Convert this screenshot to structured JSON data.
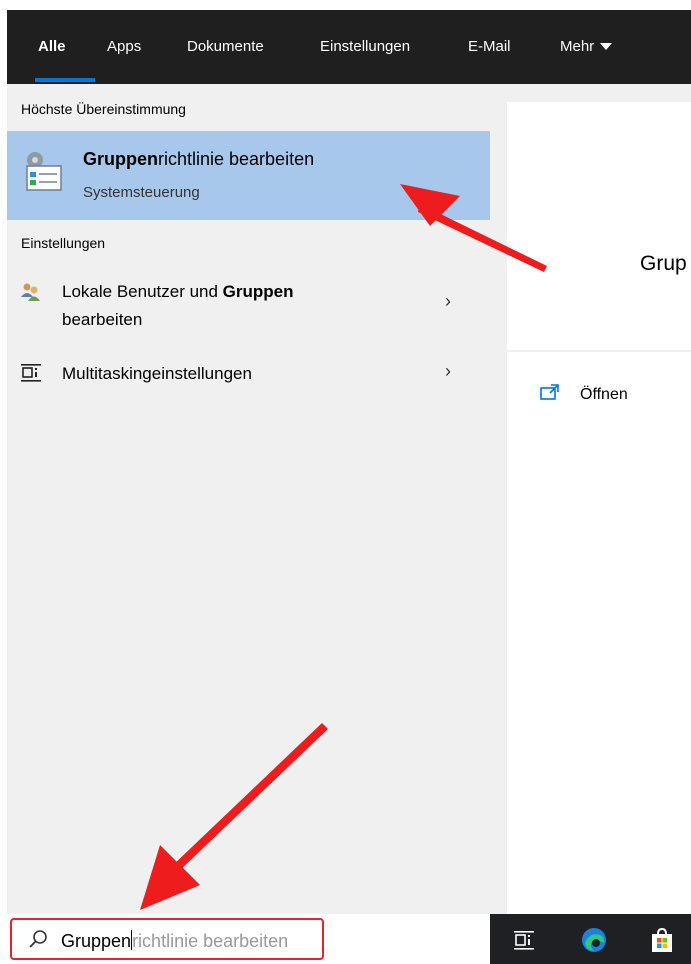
{
  "tabs": [
    {
      "label": "Alle"
    },
    {
      "label": "Apps"
    },
    {
      "label": "Dokumente"
    },
    {
      "label": "Einstellungen"
    },
    {
      "label": "E-Mail"
    },
    {
      "label": "Mehr"
    }
  ],
  "best_match": {
    "section_label": "Höchste Übereinstimmung",
    "title_bold": "Gruppen",
    "title_rest": "richtlinie bearbeiten",
    "subtitle": "Systemsteuerung",
    "icon": "group-policy-icon"
  },
  "settings": {
    "section_label": "Einstellungen",
    "items": [
      {
        "line1_prefix": "Lokale Benutzer und ",
        "line1_bold": "Gruppen",
        "line2": "bearbeiten",
        "icon": "users-icon"
      },
      {
        "label": "Multitaskingeinstellungen",
        "icon": "task-view-icon"
      }
    ]
  },
  "preview": {
    "title": "Grup",
    "open_label": "Öffnen"
  },
  "search": {
    "typed": "Gruppen",
    "suggestion": "richtlinie bearbeiten"
  },
  "colors": {
    "accent": "#0078d7",
    "selected_bg": "#a7c8eb",
    "highlight_red": "#e5252b"
  }
}
